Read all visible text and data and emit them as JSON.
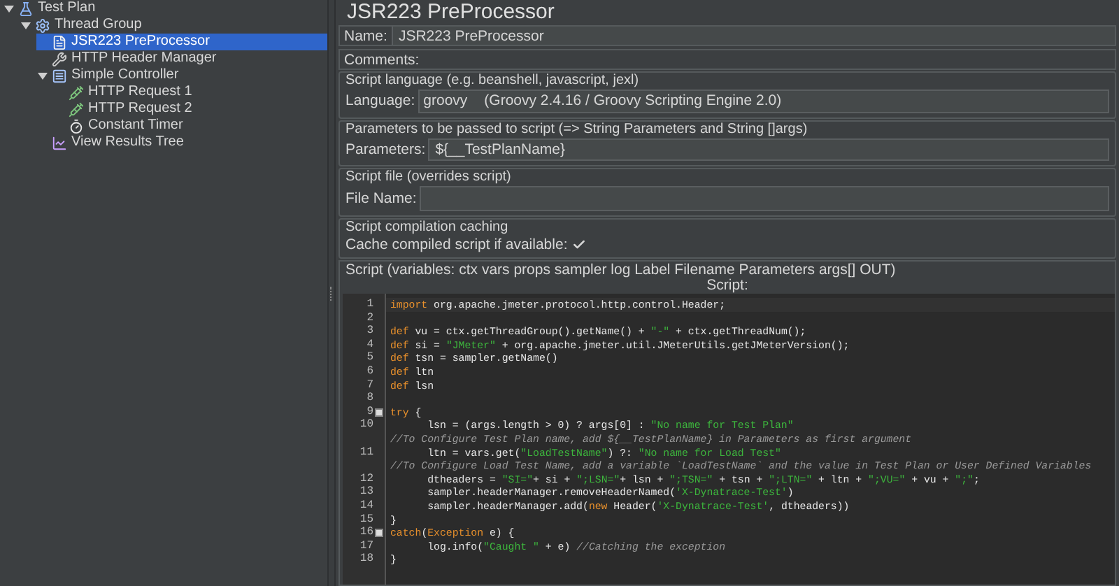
{
  "tree": [
    {
      "label": "Test Plan",
      "kind": "plan",
      "expanded": true,
      "selected": false,
      "children": [
        {
          "label": "Thread Group",
          "kind": "group",
          "expanded": true,
          "selected": false,
          "children": [
            {
              "label": "JSR223 PreProcessor",
              "kind": "preprocessor",
              "selected": true
            },
            {
              "label": "HTTP Header Manager",
              "kind": "config",
              "selected": false
            },
            {
              "label": "Simple Controller",
              "kind": "controller",
              "expanded": true,
              "selected": false,
              "children": [
                {
                  "label": "HTTP Request 1",
                  "kind": "sampler",
                  "selected": false
                },
                {
                  "label": "HTTP Request 2",
                  "kind": "sampler",
                  "selected": false
                },
                {
                  "label": "Constant Timer",
                  "kind": "timer",
                  "selected": false
                }
              ]
            },
            {
              "label": "View Results Tree",
              "kind": "listener",
              "selected": false
            }
          ]
        }
      ]
    }
  ],
  "panel": {
    "title": "JSR223 PreProcessor",
    "name": {
      "label": "Name:",
      "value": "JSR223 PreProcessor"
    },
    "comments": {
      "label": "Comments:"
    },
    "language_group": {
      "title": "Script language (e.g. beanshell, javascript, jexl)",
      "label": "Language:",
      "value": "groovy",
      "engine": "(Groovy 2.4.16 / Groovy Scripting Engine 2.0)"
    },
    "parameters_group": {
      "title": "Parameters to be passed to script (=> String Parameters and String []args)",
      "label": "Parameters:",
      "value": "${__TestPlanName}"
    },
    "file_group": {
      "title": "Script file (overrides script)",
      "label": "File Name:"
    },
    "cache_group": {
      "title": "Script compilation caching",
      "label": "Cache compiled script if available:",
      "checked": true
    },
    "script_group": {
      "title": "Script (variables: ctx vars props sampler log Label Filename Parameters args[] OUT)",
      "editor_label": "Script:",
      "lines": [
        {
          "number": "1",
          "fold": false,
          "tokens": [
            {
              "kind": "keyword",
              "text": "import"
            },
            {
              "kind": "plain",
              "text": " org.apache.jmeter.protocol.http.control.Header;"
            }
          ]
        },
        {
          "number": "2",
          "fold": false
        },
        {
          "number": "3",
          "fold": false,
          "tokens": [
            {
              "kind": "keyword",
              "text": "def"
            },
            {
              "kind": "plain",
              "text": " vu = ctx.getThreadGroup().getName() + "
            },
            {
              "kind": "string",
              "text": "\"-\""
            },
            {
              "kind": "plain",
              "text": " + ctx.getThreadNum();"
            }
          ]
        },
        {
          "number": "4",
          "fold": false,
          "tokens": [
            {
              "kind": "keyword",
              "text": "def"
            },
            {
              "kind": "plain",
              "text": " si = "
            },
            {
              "kind": "string",
              "text": "\"JMeter\""
            },
            {
              "kind": "plain",
              "text": " + org.apache.jmeter.util.JMeterUtils.getJMeterVersion();"
            }
          ]
        },
        {
          "number": "5",
          "fold": false,
          "tokens": [
            {
              "kind": "keyword",
              "text": "def"
            },
            {
              "kind": "plain",
              "text": " tsn = sampler.getName()"
            }
          ]
        },
        {
          "number": "6",
          "fold": false,
          "tokens": [
            {
              "kind": "keyword",
              "text": "def"
            },
            {
              "kind": "plain",
              "text": " ltn"
            }
          ]
        },
        {
          "number": "7",
          "fold": false,
          "tokens": [
            {
              "kind": "keyword",
              "text": "def"
            },
            {
              "kind": "plain",
              "text": " lsn"
            }
          ]
        },
        {
          "number": "8",
          "fold": false
        },
        {
          "number": "9",
          "fold": true,
          "tokens": [
            {
              "kind": "keyword",
              "text": "try"
            },
            {
              "kind": "plain",
              "text": " {"
            }
          ]
        },
        {
          "number": "10",
          "fold": false,
          "tokens": [
            {
              "kind": "plain",
              "text": "      lsn = (args.length > 0) ? args[0] : "
            },
            {
              "kind": "string",
              "text": "\"No name for Test Plan\""
            }
          ]
        },
        {
          "fold": false,
          "tokens": [
            {
              "kind": "comment",
              "text": "//To Configure Test Plan name, add ${__TestPlanName} in Parameters as first argument"
            }
          ]
        },
        {
          "number": "11",
          "fold": false,
          "tokens": [
            {
              "kind": "plain",
              "text": "      ltn = vars.get("
            },
            {
              "kind": "string",
              "text": "\"LoadTestName\""
            },
            {
              "kind": "plain",
              "text": ") ?: "
            },
            {
              "kind": "string",
              "text": "\"No name for Load Test\""
            }
          ]
        },
        {
          "fold": false,
          "tokens": [
            {
              "kind": "comment",
              "text": "//To Configure Load Test Name, add a variable `LoadTestName` and the value in Test Plan or User Defined Variables"
            }
          ]
        },
        {
          "number": "12",
          "fold": false,
          "tokens": [
            {
              "kind": "plain",
              "text": "      dtheaders = "
            },
            {
              "kind": "string",
              "text": "\"SI=\""
            },
            {
              "kind": "plain",
              "text": "+ si + "
            },
            {
              "kind": "string",
              "text": "\";LSN=\""
            },
            {
              "kind": "plain",
              "text": "+ lsn + "
            },
            {
              "kind": "string",
              "text": "\";TSN=\""
            },
            {
              "kind": "plain",
              "text": " + tsn + "
            },
            {
              "kind": "string",
              "text": "\";LTN=\""
            },
            {
              "kind": "plain",
              "text": " + ltn + "
            },
            {
              "kind": "string",
              "text": "\";VU=\""
            },
            {
              "kind": "plain",
              "text": " + vu + "
            },
            {
              "kind": "string",
              "text": "\";\""
            },
            {
              "kind": "plain",
              "text": ";"
            }
          ]
        },
        {
          "number": "13",
          "fold": false,
          "tokens": [
            {
              "kind": "plain",
              "text": "      sampler.headerManager.removeHeaderNamed("
            },
            {
              "kind": "string",
              "text": "'X-Dynatrace-Test'"
            },
            {
              "kind": "plain",
              "text": ")"
            }
          ]
        },
        {
          "number": "14",
          "fold": false,
          "tokens": [
            {
              "kind": "plain",
              "text": "      sampler.headerManager.add("
            },
            {
              "kind": "keyword",
              "text": "new"
            },
            {
              "kind": "plain",
              "text": " Header("
            },
            {
              "kind": "string",
              "text": "'X-Dynatrace-Test'"
            },
            {
              "kind": "plain",
              "text": ", dtheaders))"
            }
          ]
        },
        {
          "number": "15",
          "fold": false,
          "tokens": [
            {
              "kind": "plain",
              "text": "}"
            }
          ]
        },
        {
          "number": "16",
          "fold": true,
          "tokens": [
            {
              "kind": "keyword",
              "text": "catch"
            },
            {
              "kind": "plain",
              "text": "("
            },
            {
              "kind": "keyword",
              "text": "Exception"
            },
            {
              "kind": "plain",
              "text": " e) {"
            }
          ]
        },
        {
          "number": "17",
          "fold": false,
          "tokens": [
            {
              "kind": "plain",
              "text": "      log.info("
            },
            {
              "kind": "string",
              "text": "\"Caught \""
            },
            {
              "kind": "plain",
              "text": " + e) "
            },
            {
              "kind": "comment",
              "text": "//Catching the exception"
            }
          ]
        },
        {
          "number": "18",
          "fold": false,
          "tokens": [
            {
              "kind": "plain",
              "text": "}"
            }
          ]
        }
      ]
    }
  }
}
